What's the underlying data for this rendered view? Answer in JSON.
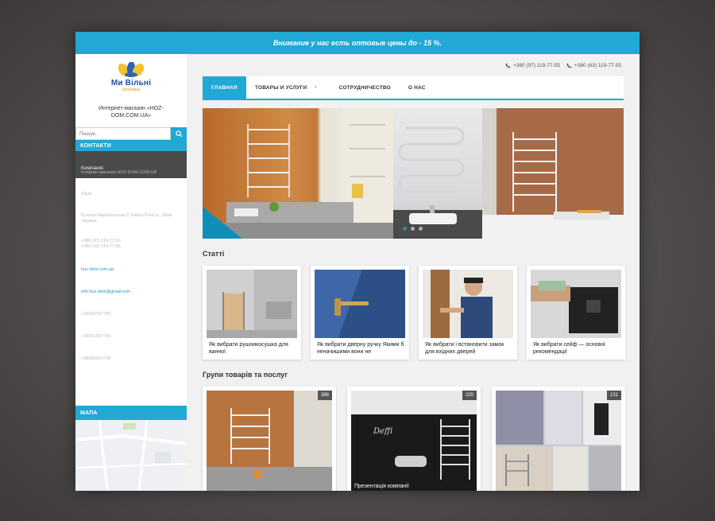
{
  "promo": {
    "text": "Внимание у нас есть оптовые цены до - 15 %."
  },
  "sidebar": {
    "logo_text": "Ми Вільні",
    "logo_sub": "підтримка",
    "shop_name": "Интернет-магазин «HOZ-DOM.COM.UA»",
    "search": {
      "placeholder": "Пошук.."
    },
    "contacts_header": "КОНТАКТИ",
    "company_label": "Компанія:",
    "contacts": [
      "Інтернет-магазин HOZ-DOM.COM.UA",
      "Юрій",
      "Вулиця Миропільська 3, Район Юність , Київ, Україна",
      "+380 (97) 119-77-55\n+380 (63) 119-77-55",
      "hoz-dom.com.ua",
      "info.hoz.dom@gmail.com",
      "+380(97)97755",
      "+380(63)97755",
      "+380(63)97755"
    ],
    "map_header": "МАПА"
  },
  "header": {
    "phones": [
      "+380 (97) 119-77-55",
      "+380 (63) 119-77-55"
    ]
  },
  "nav": {
    "items": [
      "ГЛАВНАЯ",
      "ТОВАРЫ И УСЛУГИ",
      "СОТРУДНИЧЕСТВО",
      "О НАС"
    ],
    "arrow": "›"
  },
  "articles": {
    "title": "Статті",
    "items": [
      {
        "caption": "Як вибрати рушникосушка для ванної"
      },
      {
        "caption": "Як вибрати дверну ручку Якими б неначишими вони не"
      },
      {
        "caption": "Як вибрати і встановити замок для вхідних дверей"
      },
      {
        "caption": "Як вибрати сейф — основні рекомендації"
      }
    ]
  },
  "groups": {
    "title": "Групи товарів та послуг",
    "items": [
      {
        "count": "388",
        "caption": ""
      },
      {
        "count": "220",
        "caption": "Презентація компанії"
      },
      {
        "count": "131",
        "caption": ""
      }
    ],
    "brand_text": "Deffi"
  },
  "colors": {
    "accent": "#21a8d4",
    "dark": "#4a4a4a",
    "link": "#2a91cc"
  }
}
